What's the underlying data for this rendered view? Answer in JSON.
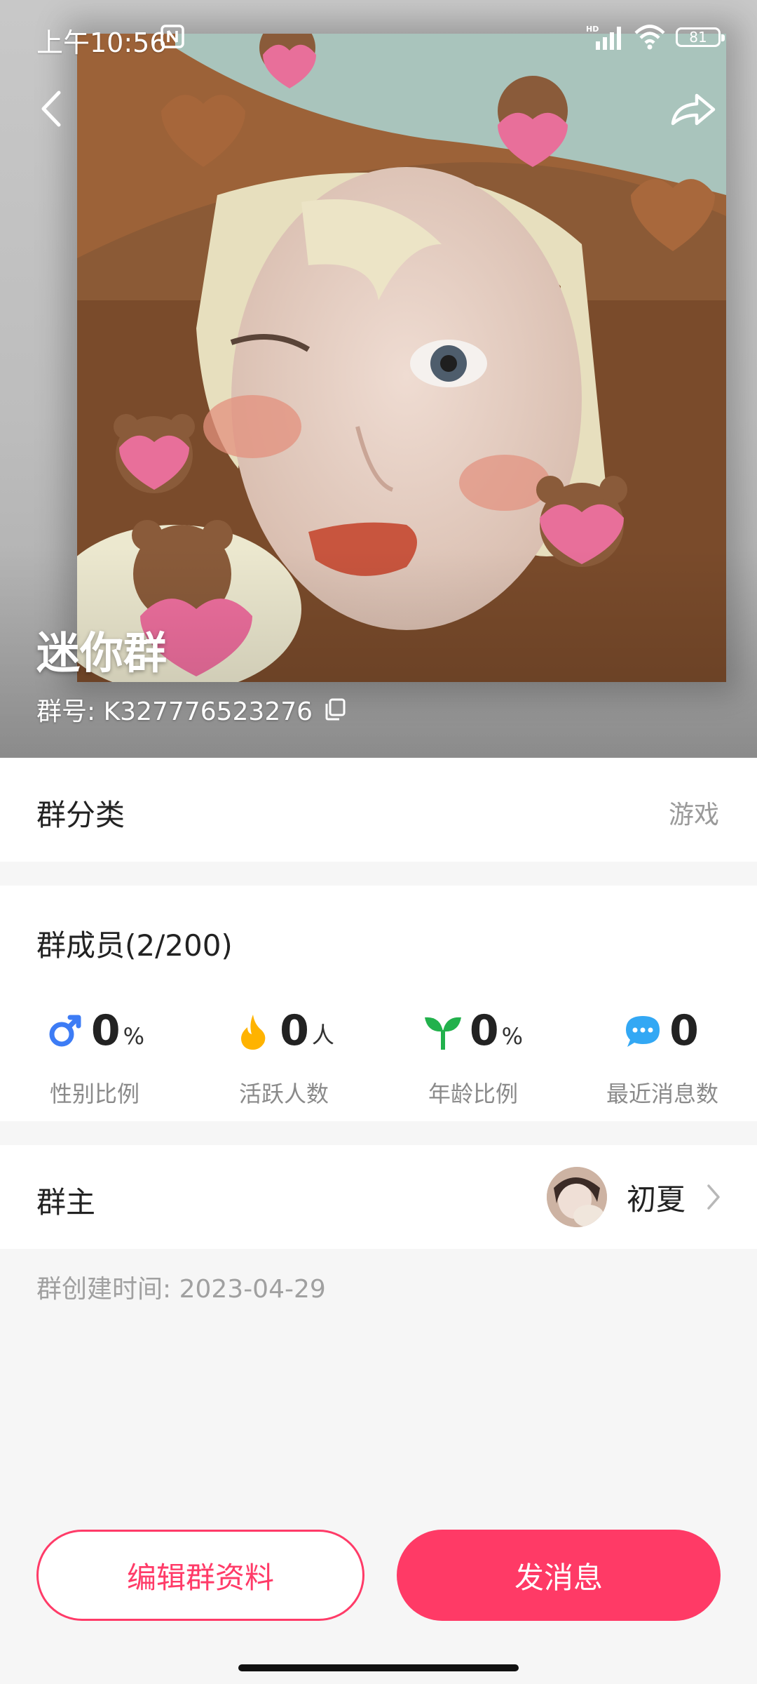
{
  "status_bar": {
    "time": "上午10:56",
    "battery": "81"
  },
  "group": {
    "name": "迷你群",
    "id_text": "群号: K327776523276"
  },
  "category": {
    "label": "群分类",
    "value": "游戏"
  },
  "members": {
    "title": "群成员(2/200)",
    "stats": [
      {
        "icon": "male-icon",
        "value": "0",
        "unit": "%",
        "label": "性别比例",
        "color": "#3d7cf5"
      },
      {
        "icon": "flame-icon",
        "value": "0",
        "unit": "人",
        "label": "活跃人数",
        "color": "#ffb300"
      },
      {
        "icon": "sprout-icon",
        "value": "0",
        "unit": "%",
        "label": "年龄比例",
        "color": "#22b14c"
      },
      {
        "icon": "chat-bubble-icon",
        "value": "0",
        "unit": "",
        "label": "最近消息数",
        "color": "#33a8f4"
      }
    ]
  },
  "owner": {
    "label": "群主",
    "name": "初夏"
  },
  "created_text": "群创建时间: 2023-04-29",
  "buttons": {
    "edit": "编辑群资料",
    "send": "发消息"
  },
  "colors": {
    "accent": "#ff3a66",
    "muted": "#9a9a9a"
  }
}
